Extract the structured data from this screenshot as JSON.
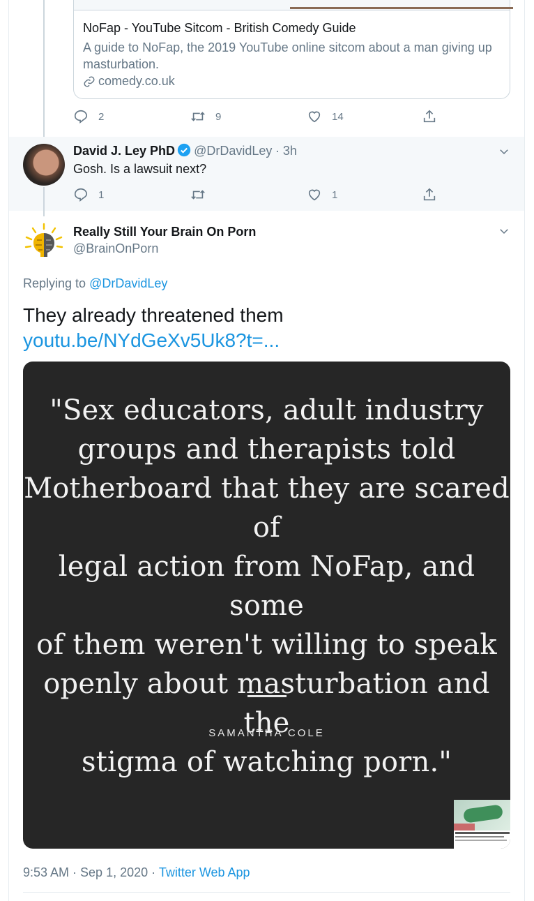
{
  "link_card": {
    "title": "NoFap - YouTube Sitcom - British Comedy Guide",
    "description": "A guide to NoFap, the 2019 YouTube online sitcom about a man giving up masturbation.",
    "domain": "comedy.co.uk"
  },
  "first_tweet_actions": {
    "replies": "2",
    "retweets": "9",
    "likes": "14"
  },
  "reply_tweet": {
    "name": "David J. Ley PhD",
    "handle": "@DrDavidLey",
    "time": "· 3h",
    "text": "Gosh. Is a lawsuit next?",
    "replies": "1",
    "likes": "1"
  },
  "main_tweet": {
    "name": "Really Still Your Brain On Porn",
    "handle": "@BrainOnPorn",
    "replying_prefix": "Replying to",
    "replying_to": "@DrDavidLey",
    "text": "They already threatened them",
    "link": "youtu.be/NYdGeXv5Uk8?t=...",
    "media": {
      "quote_lines": [
        "\"Sex educators, adult industry",
        "groups and therapists told",
        "Motherboard that they are scared of",
        "legal action from NoFap, and some",
        "of them weren't willing to speak",
        "openly about masturbation and the",
        "stigma of watching porn.\""
      ],
      "author": "SAMANTHA COLE"
    },
    "timestamp": "9:53 AM · Sep 1, 2020 ·",
    "source": "Twitter Web App"
  },
  "colors": {
    "link": "#1b95e0",
    "muted": "#657786",
    "verified": "#1da1f2"
  }
}
